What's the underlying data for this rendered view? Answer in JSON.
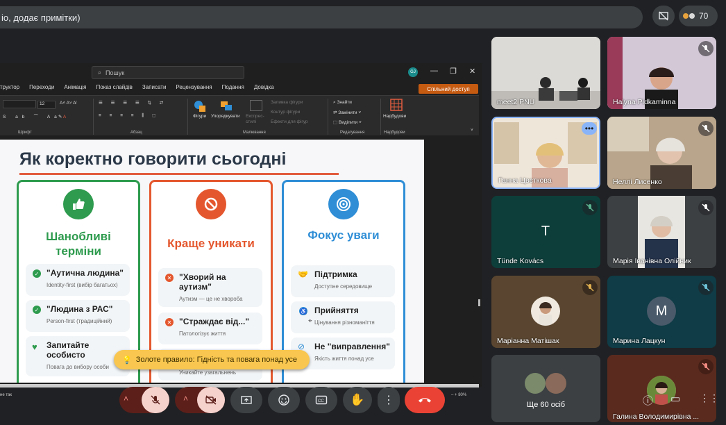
{
  "meeting": {
    "topbar_text": "іо, додає примітки)",
    "participant_count": "70"
  },
  "ppt": {
    "search_placeholder": "Пошук",
    "user_initials": "GJ",
    "menu": [
      "труктор",
      "Переходи",
      "Анімація",
      "Показ слайдів",
      "Записати",
      "Рецензування",
      "Подання",
      "Довідка"
    ],
    "share_label": "Спільний доступ",
    "font_size": "12",
    "ribbon": {
      "group_font": "Шрифт",
      "group_paragraph": "Абзац",
      "group_drawing": "Малювання",
      "group_editing": "Редагування",
      "group_addins": "Надбудови",
      "shapes": "Фігури",
      "arrange": "Упорядкувати",
      "quick_styles": "Експрес-стилі",
      "fill": "Заливка фігури",
      "outline": "Контур фігури",
      "effects": "Ефекти для фігур",
      "find": "Знайти",
      "replace": "Замінити",
      "select": "Виділити",
      "addins": "Надбудови"
    },
    "status_left": "не так",
    "zoom": "80%"
  },
  "slide": {
    "title": "Як коректно говорити сьогодні",
    "cards": [
      {
        "heading_1": "Шанобливі",
        "heading_2": "терміни",
        "items": [
          {
            "title": "\"Аутична людина\"",
            "sub": "Identity-first (вибір багатьох)"
          },
          {
            "title": "\"Людина з РАС\"",
            "sub": "Person-first (традиційний)"
          },
          {
            "title": "Запитайте особисто",
            "sub": "Повага до вибору особи"
          }
        ]
      },
      {
        "heading_1": "Краще уникати",
        "items": [
          {
            "title": "\"Хворий на аутизм\"",
            "sub": "Аутизм — це не хвороба"
          },
          {
            "title": "\"Страждає від...\"",
            "sub": "Патологізує життя"
          },
          {
            "title": "",
            "sub": "Уникайте узагальнень"
          }
        ]
      },
      {
        "heading_1": "Фокус уваги",
        "items": [
          {
            "title": "Підтримка",
            "sub": "Доступне середовище"
          },
          {
            "title": "Прийняття",
            "sub": "Цінування різноманіття"
          },
          {
            "title": "Не \"виправлення\"",
            "sub": "Якість життя понад усе"
          }
        ]
      }
    ],
    "golden_rule": "Золоте правило: Гідність та повага понад усе"
  },
  "participants": [
    {
      "name": "meet2 PNU"
    },
    {
      "name": "Halyna Pidkaminna"
    },
    {
      "name": "Ганна Цвєткова"
    },
    {
      "name": "Неллі Лисенко"
    },
    {
      "name": "Tünde Kovács",
      "initial": "T"
    },
    {
      "name": "Марія Іванівна Олійник"
    },
    {
      "name": "Маріанна Матішак"
    },
    {
      "name": "Марина Лацкун",
      "initial": "M"
    },
    {
      "name": "Ще 60 осіб"
    },
    {
      "name": "Галина Володимирівна ..."
    }
  ],
  "colors": {
    "green": "#2e9b4e",
    "red": "#e4572e",
    "blue": "#2f8ed6",
    "end_call": "#ea4335",
    "mic_off": "#f6d2cd"
  }
}
